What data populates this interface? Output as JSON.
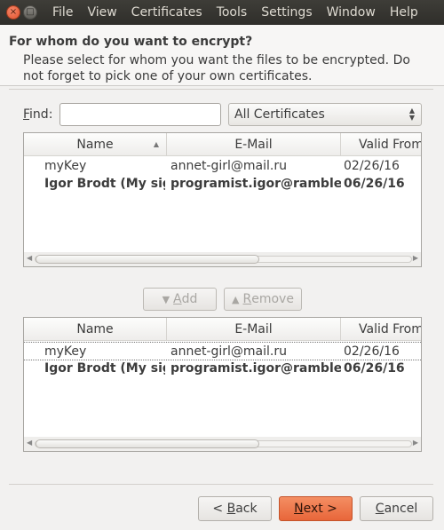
{
  "window": {
    "close_glyph": "×",
    "maximize_glyph": "□"
  },
  "menu": [
    "File",
    "View",
    "Certificates",
    "Tools",
    "Settings",
    "Window",
    "Help"
  ],
  "header": {
    "title": "For whom do you want to encrypt?",
    "subtitle": "Please select for whom you want the files to be encrypted. Do not forget to pick one of your own certificates."
  },
  "find": {
    "label_prefix": "",
    "label_mnemonic": "F",
    "label_rest": "ind:",
    "value": "",
    "filter_selected": "All Certificates"
  },
  "columns": {
    "name": "Name",
    "email": "E-Mail",
    "valid_from": "Valid From"
  },
  "available_certs": [
    {
      "name": "myKey",
      "email": "annet-girl@mail.ru",
      "valid_from": "02/26/16",
      "bold": false
    },
    {
      "name": "Igor Brodt (My sign)",
      "email": "programist.igor@rambler.ru",
      "valid_from": "06/26/16",
      "bold": true
    }
  ],
  "selected_certs": [
    {
      "name": "myKey",
      "email": "annet-girl@mail.ru",
      "valid_from": "02/26/16",
      "bold": false
    },
    {
      "name": "Igor Brodt (My sign)",
      "email": "programist.igor@rambler.ru",
      "valid_from": "06/26/16",
      "bold": true
    }
  ],
  "actions": {
    "add_mnemonic": "A",
    "add_rest": "dd",
    "remove_mnemonic": "R",
    "remove_rest": "emove"
  },
  "footer": {
    "back_prefix": "< ",
    "back_mnemonic": "B",
    "back_rest": "ack",
    "next_mnemonic": "N",
    "next_rest": "ext >",
    "cancel_mnemonic": "C",
    "cancel_rest": "ancel"
  },
  "colors": {
    "menubar": "#2f2e2a",
    "accent_next": "#e8663a",
    "window_bg": "#f2f1f0"
  }
}
